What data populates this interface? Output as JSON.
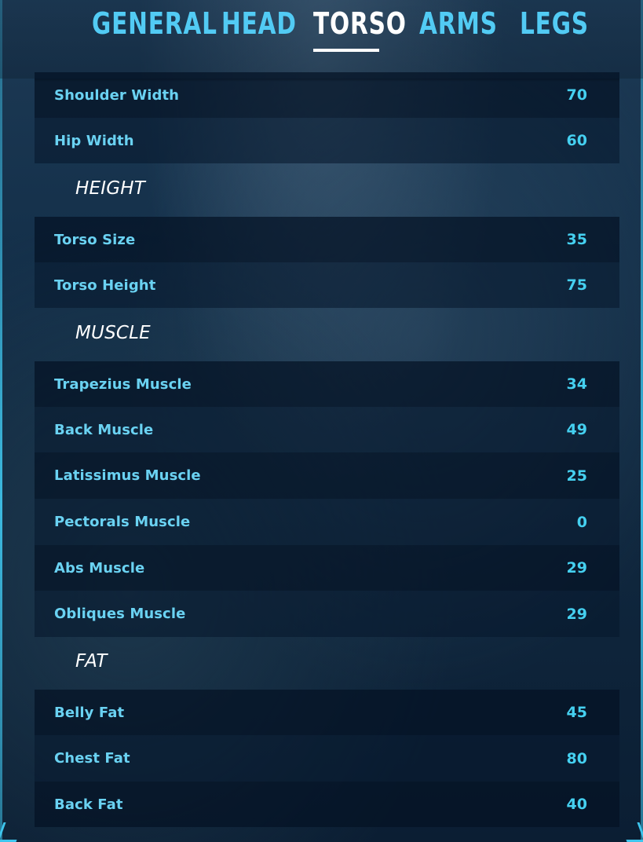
{
  "tabs": [
    {
      "label": "GENERAL",
      "active": false
    },
    {
      "label": "HEAD",
      "active": false
    },
    {
      "label": "TORSO",
      "active": true
    },
    {
      "label": "ARMS",
      "active": false
    },
    {
      "label": "LEGS",
      "active": false
    }
  ],
  "top_rows": [
    {
      "label": "Shoulder Width",
      "value": "70"
    },
    {
      "label": "Hip Width",
      "value": "60"
    }
  ],
  "height_section": {
    "title": "HEIGHT",
    "rows": [
      {
        "label": "Torso Size",
        "value": "35"
      },
      {
        "label": "Torso Height",
        "value": "75"
      }
    ]
  },
  "muscle_section": {
    "title": "MUSCLE",
    "rows": [
      {
        "label": "Trapezius Muscle",
        "value": "34"
      },
      {
        "label": "Back Muscle",
        "value": "49"
      },
      {
        "label": "Latissimus Muscle",
        "value": "25"
      },
      {
        "label": "Pectorals Muscle",
        "value": "0"
      },
      {
        "label": "Abs Muscle",
        "value": "29"
      },
      {
        "label": "Obliques Muscle",
        "value": "29"
      }
    ]
  },
  "fat_section": {
    "title": "FAT",
    "rows": [
      {
        "label": "Belly Fat",
        "value": "45"
      },
      {
        "label": "Chest Fat",
        "value": "80"
      },
      {
        "label": "Back Fat",
        "value": "40"
      }
    ]
  },
  "colors": {
    "accent": "#45d0f0",
    "label": "#6ad2f2",
    "active_tab": "#ffffff",
    "section_header": "#ffffff"
  }
}
